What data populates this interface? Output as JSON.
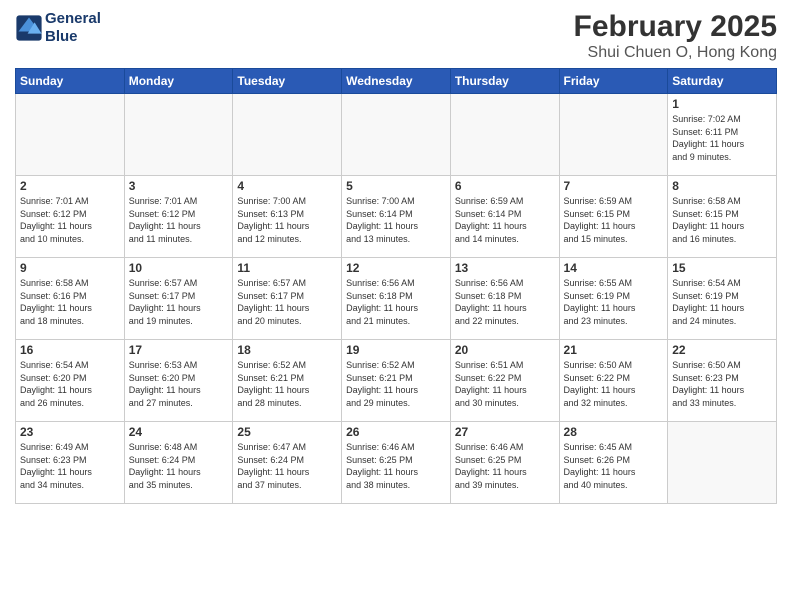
{
  "header": {
    "logo_line1": "General",
    "logo_line2": "Blue",
    "title": "February 2025",
    "subtitle": "Shui Chuen O, Hong Kong"
  },
  "weekdays": [
    "Sunday",
    "Monday",
    "Tuesday",
    "Wednesday",
    "Thursday",
    "Friday",
    "Saturday"
  ],
  "weeks": [
    [
      {
        "day": "",
        "info": ""
      },
      {
        "day": "",
        "info": ""
      },
      {
        "day": "",
        "info": ""
      },
      {
        "day": "",
        "info": ""
      },
      {
        "day": "",
        "info": ""
      },
      {
        "day": "",
        "info": ""
      },
      {
        "day": "1",
        "info": "Sunrise: 7:02 AM\nSunset: 6:11 PM\nDaylight: 11 hours\nand 9 minutes."
      }
    ],
    [
      {
        "day": "2",
        "info": "Sunrise: 7:01 AM\nSunset: 6:12 PM\nDaylight: 11 hours\nand 10 minutes."
      },
      {
        "day": "3",
        "info": "Sunrise: 7:01 AM\nSunset: 6:12 PM\nDaylight: 11 hours\nand 11 minutes."
      },
      {
        "day": "4",
        "info": "Sunrise: 7:00 AM\nSunset: 6:13 PM\nDaylight: 11 hours\nand 12 minutes."
      },
      {
        "day": "5",
        "info": "Sunrise: 7:00 AM\nSunset: 6:14 PM\nDaylight: 11 hours\nand 13 minutes."
      },
      {
        "day": "6",
        "info": "Sunrise: 6:59 AM\nSunset: 6:14 PM\nDaylight: 11 hours\nand 14 minutes."
      },
      {
        "day": "7",
        "info": "Sunrise: 6:59 AM\nSunset: 6:15 PM\nDaylight: 11 hours\nand 15 minutes."
      },
      {
        "day": "8",
        "info": "Sunrise: 6:58 AM\nSunset: 6:15 PM\nDaylight: 11 hours\nand 16 minutes."
      }
    ],
    [
      {
        "day": "9",
        "info": "Sunrise: 6:58 AM\nSunset: 6:16 PM\nDaylight: 11 hours\nand 18 minutes."
      },
      {
        "day": "10",
        "info": "Sunrise: 6:57 AM\nSunset: 6:17 PM\nDaylight: 11 hours\nand 19 minutes."
      },
      {
        "day": "11",
        "info": "Sunrise: 6:57 AM\nSunset: 6:17 PM\nDaylight: 11 hours\nand 20 minutes."
      },
      {
        "day": "12",
        "info": "Sunrise: 6:56 AM\nSunset: 6:18 PM\nDaylight: 11 hours\nand 21 minutes."
      },
      {
        "day": "13",
        "info": "Sunrise: 6:56 AM\nSunset: 6:18 PM\nDaylight: 11 hours\nand 22 minutes."
      },
      {
        "day": "14",
        "info": "Sunrise: 6:55 AM\nSunset: 6:19 PM\nDaylight: 11 hours\nand 23 minutes."
      },
      {
        "day": "15",
        "info": "Sunrise: 6:54 AM\nSunset: 6:19 PM\nDaylight: 11 hours\nand 24 minutes."
      }
    ],
    [
      {
        "day": "16",
        "info": "Sunrise: 6:54 AM\nSunset: 6:20 PM\nDaylight: 11 hours\nand 26 minutes."
      },
      {
        "day": "17",
        "info": "Sunrise: 6:53 AM\nSunset: 6:20 PM\nDaylight: 11 hours\nand 27 minutes."
      },
      {
        "day": "18",
        "info": "Sunrise: 6:52 AM\nSunset: 6:21 PM\nDaylight: 11 hours\nand 28 minutes."
      },
      {
        "day": "19",
        "info": "Sunrise: 6:52 AM\nSunset: 6:21 PM\nDaylight: 11 hours\nand 29 minutes."
      },
      {
        "day": "20",
        "info": "Sunrise: 6:51 AM\nSunset: 6:22 PM\nDaylight: 11 hours\nand 30 minutes."
      },
      {
        "day": "21",
        "info": "Sunrise: 6:50 AM\nSunset: 6:22 PM\nDaylight: 11 hours\nand 32 minutes."
      },
      {
        "day": "22",
        "info": "Sunrise: 6:50 AM\nSunset: 6:23 PM\nDaylight: 11 hours\nand 33 minutes."
      }
    ],
    [
      {
        "day": "23",
        "info": "Sunrise: 6:49 AM\nSunset: 6:23 PM\nDaylight: 11 hours\nand 34 minutes."
      },
      {
        "day": "24",
        "info": "Sunrise: 6:48 AM\nSunset: 6:24 PM\nDaylight: 11 hours\nand 35 minutes."
      },
      {
        "day": "25",
        "info": "Sunrise: 6:47 AM\nSunset: 6:24 PM\nDaylight: 11 hours\nand 37 minutes."
      },
      {
        "day": "26",
        "info": "Sunrise: 6:46 AM\nSunset: 6:25 PM\nDaylight: 11 hours\nand 38 minutes."
      },
      {
        "day": "27",
        "info": "Sunrise: 6:46 AM\nSunset: 6:25 PM\nDaylight: 11 hours\nand 39 minutes."
      },
      {
        "day": "28",
        "info": "Sunrise: 6:45 AM\nSunset: 6:26 PM\nDaylight: 11 hours\nand 40 minutes."
      },
      {
        "day": "",
        "info": ""
      }
    ]
  ]
}
